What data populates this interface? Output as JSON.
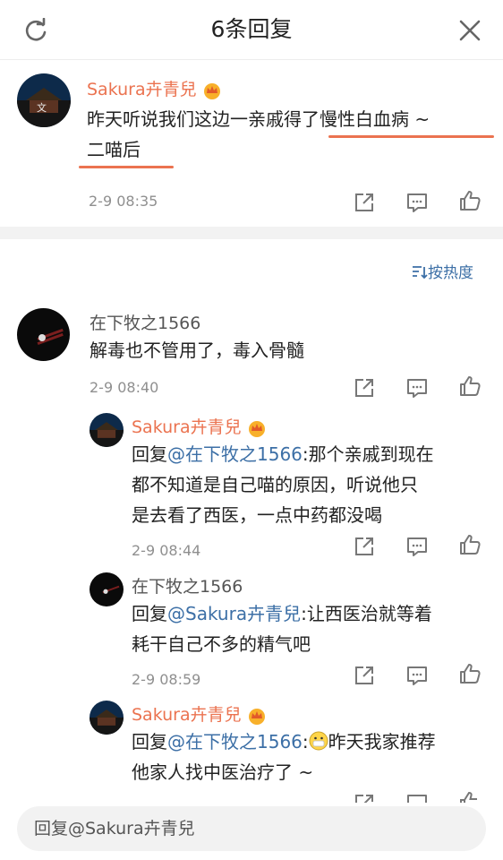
{
  "header": {
    "title": "6条回复",
    "refresh_icon": "refresh-icon",
    "close_icon": "close-icon"
  },
  "main_comment": {
    "user": "Sakura卉青兒",
    "badge": "crown-icon",
    "text_line1": "昨天听说我们这边一亲戚得了慢性白血病 ~",
    "text_line2": "二喵后",
    "time": "2-9 08:35"
  },
  "sort": {
    "label": "按热度",
    "icon": "sort-icon"
  },
  "comment": {
    "user": "在下牧之1566",
    "text": "解毒也不管用了，毒入骨髓",
    "time": "2-9 08:40"
  },
  "replies": [
    {
      "user": "Sakura卉青兒",
      "prefix": "回复",
      "mention": "@在下牧之1566",
      "line1_rest": ":那个亲戚到现在",
      "line2": "都不知道是自己喵的原因，听说他只",
      "line3": "是去看了西医，一点中药都没喝",
      "time": "2-9 08:44"
    },
    {
      "user": "在下牧之1566",
      "prefix": "回复",
      "mention": "@Sakura卉青兒",
      "line1_rest": ":让西医治就等着",
      "line2": "耗干自己不多的精气吧",
      "time": "2-9 08:59"
    },
    {
      "user": "Sakura卉青兒",
      "prefix": "回复",
      "mention": "@在下牧之1566",
      "emoji": "mask-face-emoji",
      "line1_rest": "昨天我家推荐",
      "line2": "他家人找中医治疗了 ~"
    }
  ],
  "actions": {
    "share_icon": "share-icon",
    "comment_icon": "comment-icon",
    "like_icon": "like-icon"
  },
  "reply_input": {
    "placeholder": "回复@Sakura卉青兒"
  },
  "colors": {
    "accent": "#eb7350",
    "link": "#3c6fa6",
    "band": "#f2f2f2"
  }
}
